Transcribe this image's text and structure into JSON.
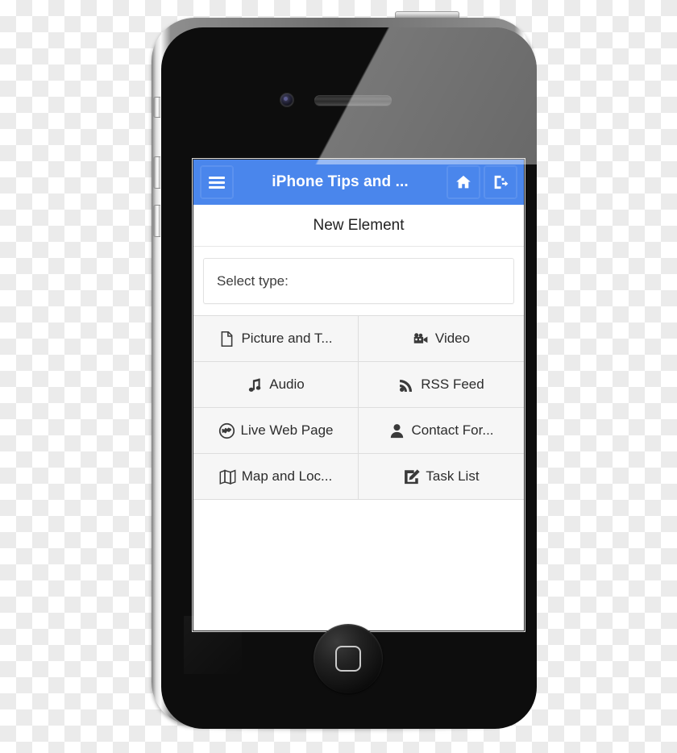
{
  "app": {
    "header": {
      "menu_icon": "hamburger-menu-icon",
      "title": "iPhone Tips and ...",
      "home_icon": "home-icon",
      "logout_icon": "sign-out-icon",
      "background_color": "#4a86ec",
      "text_color": "#ffffff"
    },
    "page_title": "New Element",
    "select": {
      "label": "Select type:",
      "placeholder": "Select type:"
    },
    "type_grid": {
      "columns": 2,
      "cell_background": "#f6f6f6",
      "border_color": "#dddddd",
      "items": [
        {
          "label": "Picture and T...",
          "full_label": "Picture and Text",
          "icon": "document-page-icon"
        },
        {
          "label": "Video",
          "full_label": "Video",
          "icon": "video-camera-icon"
        },
        {
          "label": "Audio",
          "full_label": "Audio",
          "icon": "music-note-icon"
        },
        {
          "label": "RSS Feed",
          "full_label": "RSS Feed",
          "icon": "rss-feed-icon"
        },
        {
          "label": "Live Web Page",
          "full_label": "Live Web Page",
          "icon": "globe-icon"
        },
        {
          "label": "Contact For...",
          "full_label": "Contact Form",
          "icon": "person-icon"
        },
        {
          "label": "Map and Loc...",
          "full_label": "Map and Location",
          "icon": "map-folded-icon"
        },
        {
          "label": "Task List",
          "full_label": "Task List",
          "icon": "pencil-square-icon"
        }
      ]
    }
  },
  "device": {
    "type": "iphone-4",
    "body_color": "#0d0d0d",
    "bezel_color": "#6e6e6e",
    "parts": {
      "power_button": "power-button",
      "front_camera": "front-camera",
      "earpiece": "earpiece-speaker",
      "home_button": "home-button",
      "mute_switch": "mute-switch",
      "volume_up": "volume-up-button",
      "volume_down": "volume-down-button"
    }
  },
  "background": {
    "style": "transparency-checkerboard",
    "light": "#ffffff",
    "dark": "#ebebeb",
    "tile_size_px": 20
  }
}
